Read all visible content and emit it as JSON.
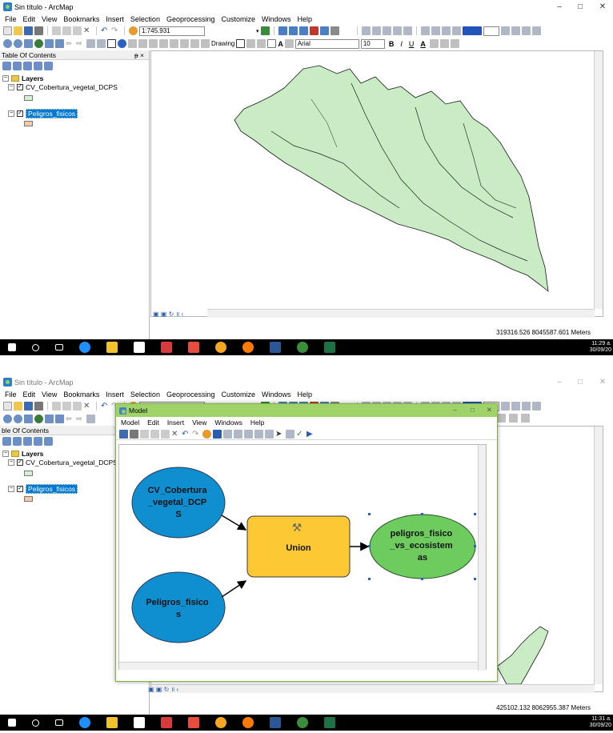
{
  "app": {
    "title": "Sin título - ArcMap",
    "menu": [
      "File",
      "Edit",
      "View",
      "Bookmarks",
      "Insert",
      "Selection",
      "Geoprocessing",
      "Customize",
      "Windows",
      "Help"
    ],
    "scale": "1:745.931",
    "drawing_label": "Drawing",
    "font_name": "Arial",
    "font_size": "10",
    "bold": "B",
    "italic": "I",
    "underline": "U",
    "font_color_glyph": "A"
  },
  "toc": {
    "title": "Table Of Contents",
    "title_cropped": "ble Of Contents",
    "pin": "ᵽ ×",
    "layers_label": "Layers",
    "layer1": "CV_Cobertura_vegetal_DCPS",
    "layer2": "Peligros_fisicos",
    "colors": {
      "layer1": "#d5f0d5",
      "layer2": "#f5c9a8"
    }
  },
  "shot1": {
    "coords": "319316.526  8045587.601 Meters",
    "clock_time": "11:29 a.",
    "clock_date": "30/09/20"
  },
  "shot2": {
    "coords": "425102.132  8062955.387 Meters",
    "clock_time": "11:31 a.",
    "clock_date": "30/09/20"
  },
  "model": {
    "title": "Model",
    "menu": [
      "Model",
      "Edit",
      "Insert",
      "View",
      "Windows",
      "Help"
    ],
    "nodes": {
      "input1": [
        "CV_Cobertura",
        "_vegetal_DCP",
        "S"
      ],
      "input2": [
        "Peligros_fisico",
        "s"
      ],
      "tool": "Union",
      "output": [
        "peligros_fisico",
        "_vs_ecosistem",
        "as"
      ]
    },
    "colors": {
      "input": "#0f8fd0",
      "tool": "#fcc934",
      "output": "#6dcc5d",
      "map_fill": "#c9ecc5"
    }
  }
}
